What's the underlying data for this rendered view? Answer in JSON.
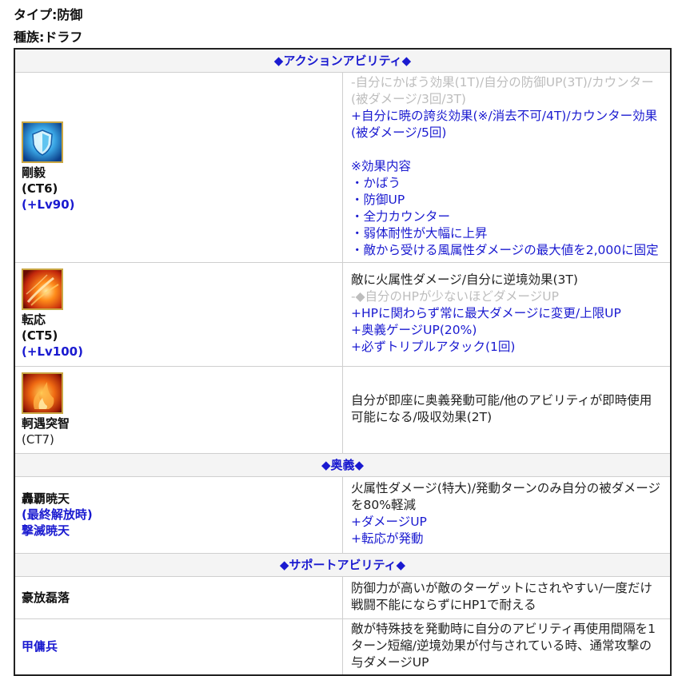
{
  "type_label": "タイプ:防御",
  "race_label": "種族:ドラフ",
  "action_header": "◆アクションアビリティ◆",
  "ougi_header": "◆奥義◆",
  "support_header": "◆サポートアビリティ◆",
  "abilities": [
    {
      "icon": "shield-icon",
      "name": "剛毅",
      "ct": "(CT6)",
      "lv": "(+Lv90)",
      "lines": [
        "-自分にかばう効果(1T)/自分の防御UP(3T)/カウンター(被ダメージ/3回/3T)",
        "+自分に暁の誇炎効果(※/消去不可/4T)/カウンター効果(被ダメージ/5回)",
        "",
        "※効果内容",
        "・かばう",
        "・防御UP",
        "・全力カウンター",
        "・弱体耐性が大幅に上昇",
        "・敵から受ける風属性ダメージの最大値を2,000に固定"
      ]
    },
    {
      "icon": "fire-icon",
      "name": "転応",
      "ct": "(CT5)",
      "lv": "(+Lv100)",
      "lines": [
        "敵に火属性ダメージ/自分に逆境効果(3T)",
        "-◆自分のHPが少ないほどダメージUP",
        "+HPに関わらず常に最大ダメージに変更/上限UP",
        "+奥義ゲージUP(20%)",
        "+必ずトリプルアタック(1回)"
      ]
    },
    {
      "icon": "flame-burst-icon",
      "name": "軻遇突智",
      "ct": "(CT7)",
      "lines": [
        "自分が即座に奥義発動可能/他のアビリティが即時使用可能になる/吸収効果(2T)"
      ]
    }
  ],
  "ougi": {
    "name": "轟覇暁天",
    "sub": "(最終解放時)",
    "sub_name": "撃滅暁天",
    "lines": [
      "火属性ダメージ(特大)/発動ターンのみ自分の被ダメージを80%軽減",
      "+ダメージUP",
      "+転応が発動"
    ]
  },
  "support": [
    {
      "name": "豪放磊落",
      "text": "防御力が高いが敵のターゲットにされやすい/一度だけ戦闘不能にならずにHP1で耐える"
    },
    {
      "name": "甲傭兵",
      "text": "敵が特殊技を発動時に自分のアビリティ再使用間隔を1ターン短縮/逆境効果が付与されている時、通常攻撃の与ダメージUP"
    }
  ],
  "colors": {
    "accent_blue": "#1a1ad0",
    "removed_gray": "#bdbdbd",
    "icon_border": "#c9a643"
  }
}
